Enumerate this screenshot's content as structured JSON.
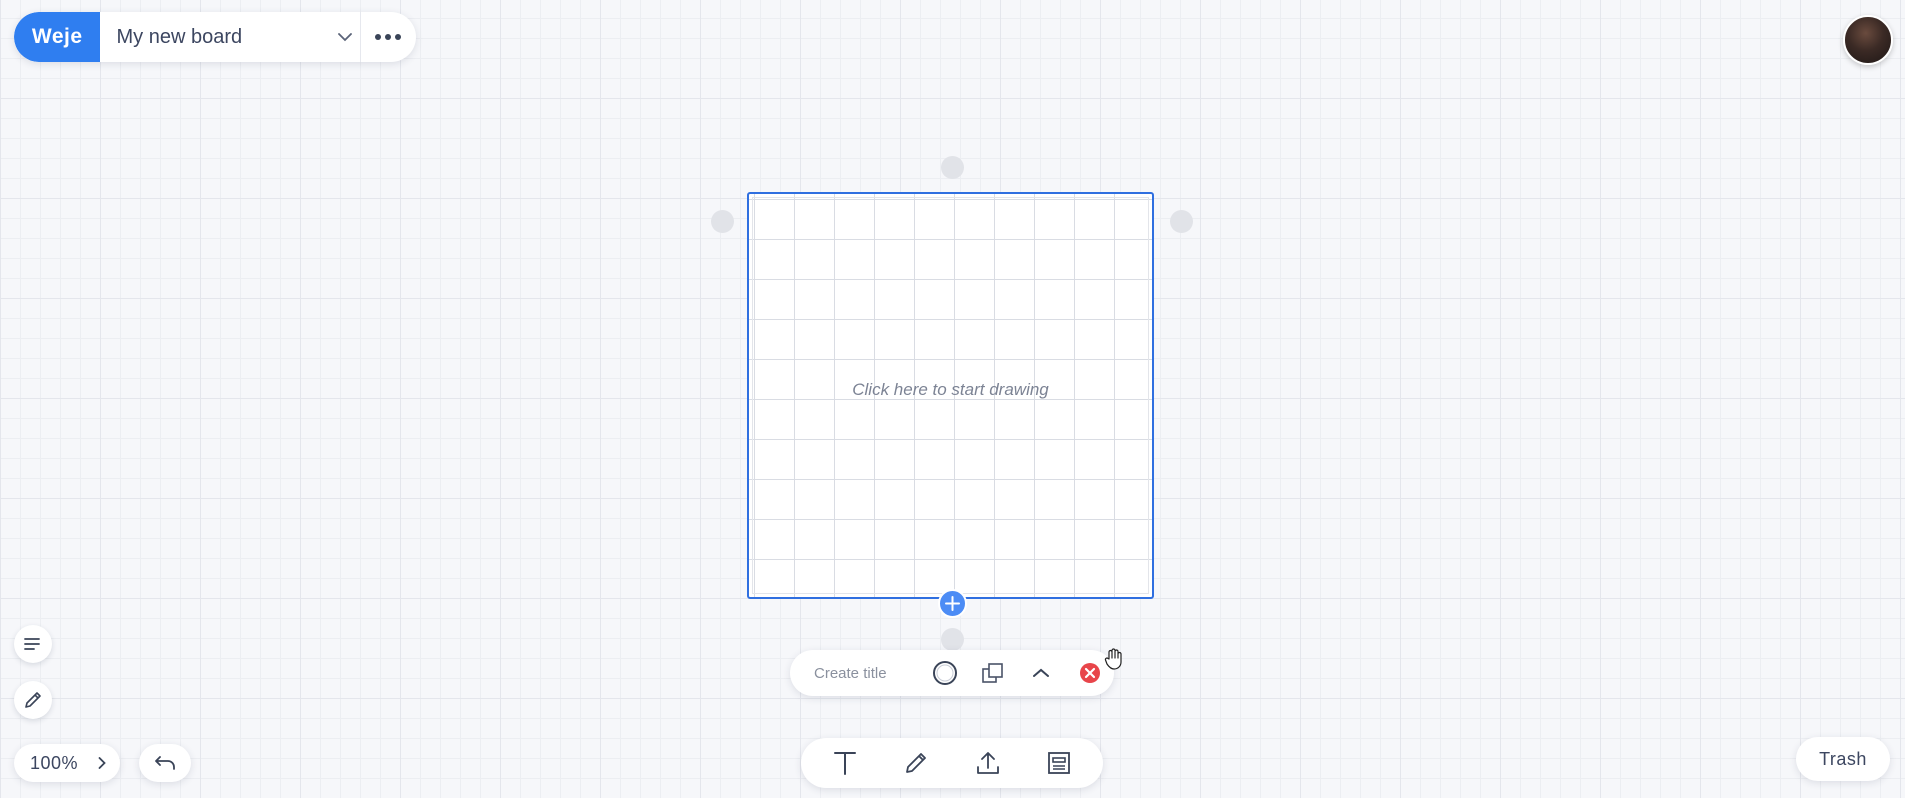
{
  "header": {
    "logo": "Weje",
    "board_title": "My new board",
    "icons": {
      "dropdown": "chevron-down-icon",
      "more": "more-horizontal-icon"
    }
  },
  "avatar": {
    "icon": "user-avatar"
  },
  "canvas": {
    "drawing_hint": "Click here to start drawing",
    "accent_color": "#2f6fe0"
  },
  "element_toolbar": {
    "title_placeholder": "Create title",
    "icons": [
      "circle-color-icon",
      "duplicate-icon",
      "chevron-up-icon",
      "close-icon"
    ],
    "close_color": "#e8454a"
  },
  "main_toolbar": {
    "icons": [
      "text-icon",
      "pencil-icon",
      "upload-icon",
      "template-icon"
    ]
  },
  "left_tools": {
    "icons": [
      "outline-icon",
      "pen-icon"
    ]
  },
  "zoom": {
    "value": "100%"
  },
  "trash": {
    "label": "Trash"
  },
  "brand_color": "#2f7ef0"
}
